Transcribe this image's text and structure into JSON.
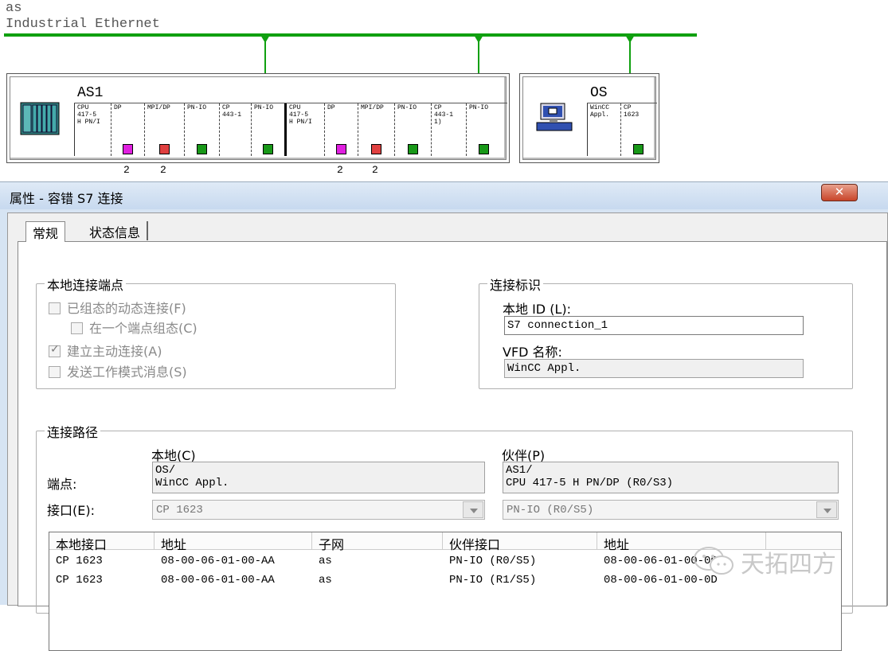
{
  "network": {
    "subnet_name": "as",
    "subnet_type": "Industrial Ethernet",
    "colors": {
      "subnet": "#10a010",
      "port_dp": "#e020e0",
      "port_mpi": "#e04040",
      "port_pn": "#189818"
    },
    "stations": [
      {
        "name": "AS1",
        "icon": "rack-icon",
        "slots": [
          {
            "label": "CPU\n417-5\nH PN/I",
            "port": ""
          },
          {
            "label": "DP",
            "port": "dp",
            "number": "2"
          },
          {
            "label": "MPI/DP",
            "port": "mpi",
            "number": "2"
          },
          {
            "label": "PN-IO",
            "port": "pn"
          },
          {
            "label": "CP\n443-1",
            "port": ""
          },
          {
            "label": "PN-IO",
            "port": "pn"
          },
          {
            "label": "CPU\n417-5\nH PN/I",
            "port": ""
          },
          {
            "label": "DP",
            "port": "dp",
            "number": "2"
          },
          {
            "label": "MPI/DP",
            "port": "mpi",
            "number": "2"
          },
          {
            "label": "PN-IO",
            "port": "pn"
          },
          {
            "label": "CP\n443-1\n1)",
            "port": ""
          },
          {
            "label": "PN-IO",
            "port": "pn"
          }
        ]
      },
      {
        "name": "OS",
        "icon": "pc-icon",
        "slots": [
          {
            "label": "WinCC\nAppl.",
            "port": ""
          },
          {
            "label": "CP\n1623",
            "port": "pn"
          }
        ]
      }
    ]
  },
  "dialog": {
    "title": "属性 - 容错 S7 连接",
    "close_symbol": "✕",
    "tabs": [
      "常规",
      "状态信息"
    ],
    "local_endpoint": {
      "label": "本地连接端点",
      "options": [
        {
          "label": "已组态的动态连接(F)",
          "checked": false
        },
        {
          "label": "在一个端点组态(C)",
          "checked": false
        },
        {
          "label": "建立主动连接(A)",
          "checked": true
        },
        {
          "label": "发送工作模式消息(S)",
          "checked": false
        }
      ]
    },
    "connection_id": {
      "label": "连接标识",
      "local_id_label": "本地 ID (L):",
      "local_id_value": "S7 connection_1",
      "vfd_label": "VFD 名称:",
      "vfd_value": "WinCC Appl."
    },
    "path": {
      "label": "连接路径",
      "local_header": "本地(C)",
      "partner_header": "伙伴(P)",
      "endpoint_label": "端点:",
      "interface_label": "接口(E):",
      "local_endpoint_line1": "OS/",
      "local_endpoint_line2": "WinCC Appl.",
      "partner_endpoint_line1": "AS1/",
      "partner_endpoint_line2": "CPU 417-5 H PN/DP (R0/S3)",
      "local_interface": "CP 1623",
      "partner_interface": "PN-IO (R0/S5)"
    },
    "table": {
      "columns": [
        "本地接口",
        "地址",
        "子网",
        "伙伴接口",
        "地址"
      ],
      "rows": [
        [
          "CP 1623",
          "08-00-06-01-00-AA",
          "as",
          "PN-IO (R0/S5)",
          "08-00-06-01-00-0C"
        ],
        [
          "CP 1623",
          "08-00-06-01-00-AA",
          "as",
          "PN-IO (R1/S5)",
          "08-00-06-01-00-0D"
        ]
      ]
    }
  },
  "watermark": {
    "text": "天拓四方",
    "icon": "wechat-icon"
  }
}
